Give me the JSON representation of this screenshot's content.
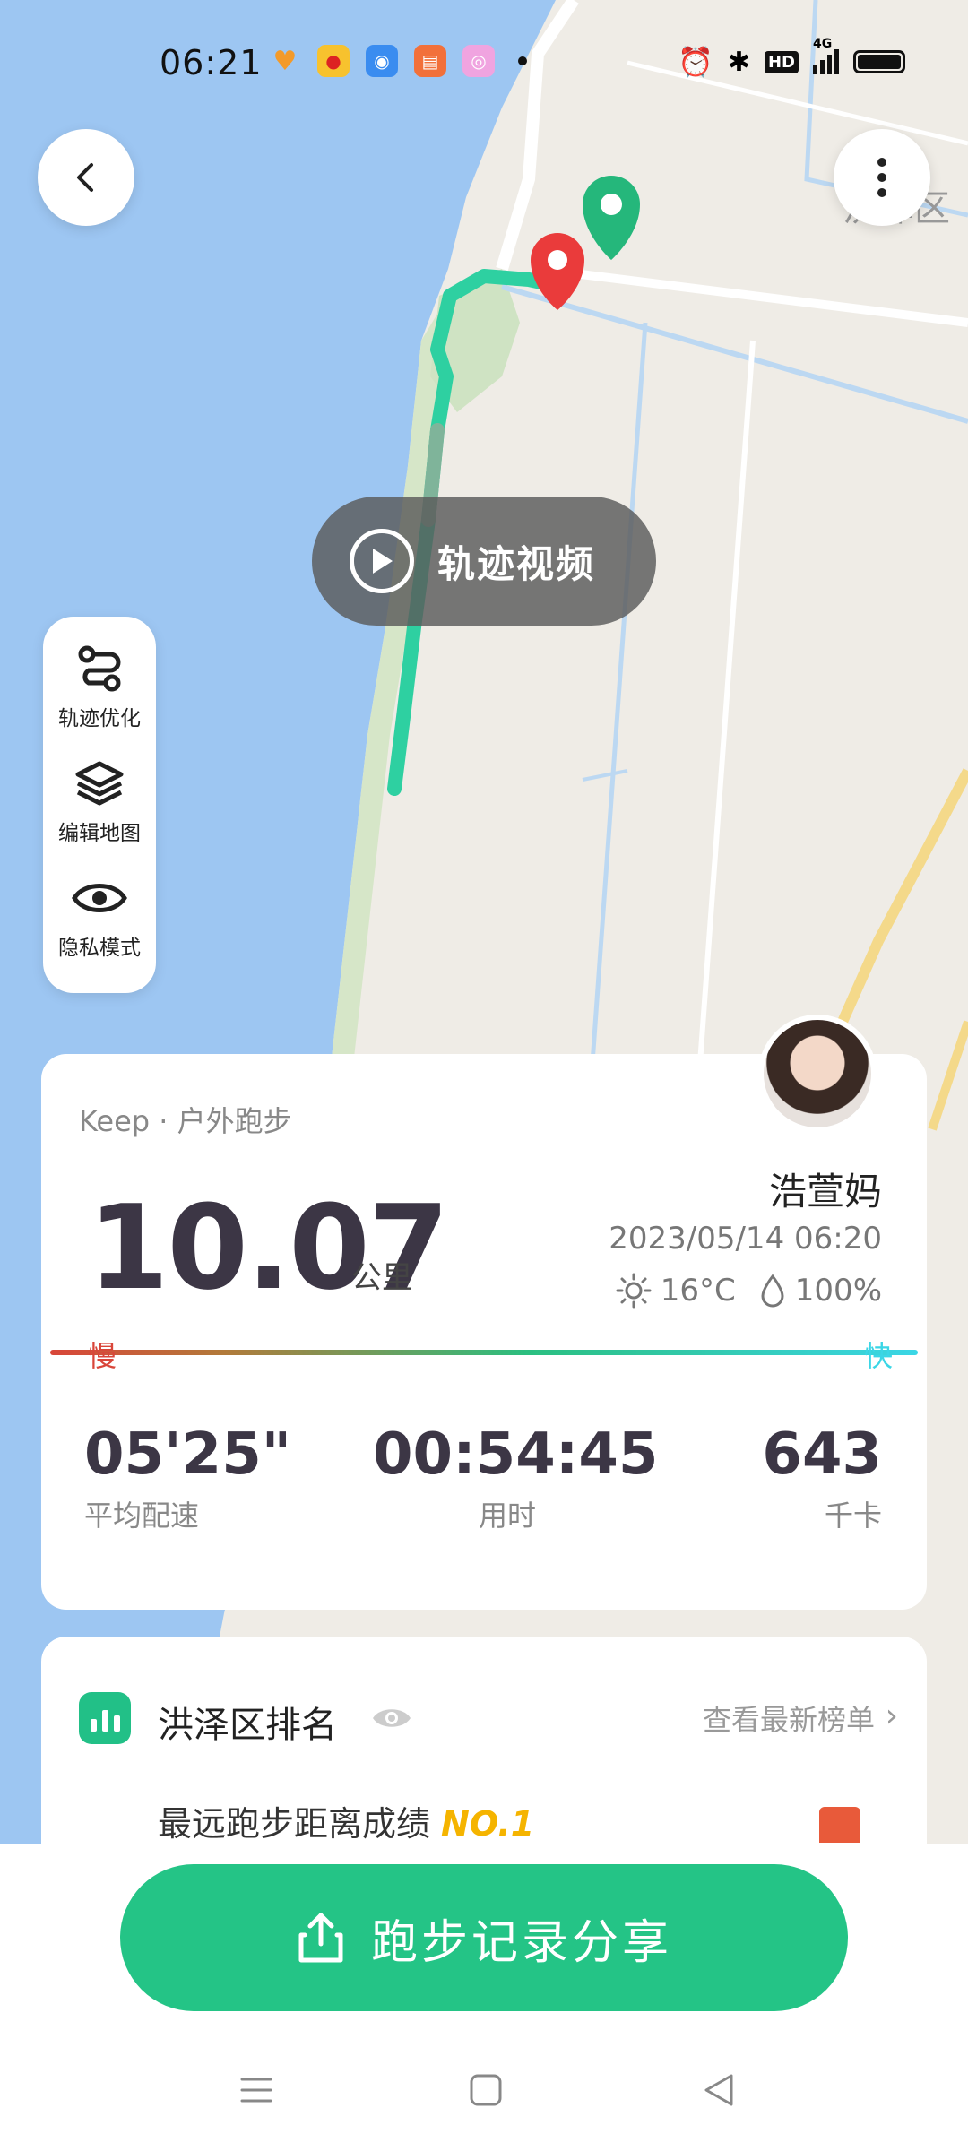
{
  "status_bar": {
    "time": "06:21",
    "network": "4G",
    "hd": "HD"
  },
  "map": {
    "district_label": "洪泽区",
    "video_button_label": "轨迹视频"
  },
  "map_tools": [
    {
      "label": "轨迹优化",
      "icon": "route-optimize-icon"
    },
    {
      "label": "编辑地图",
      "icon": "layers-icon"
    },
    {
      "label": "隐私模式",
      "icon": "eye-icon"
    }
  ],
  "summary": {
    "source": "Keep · 户外跑步",
    "distance": "10.07",
    "distance_unit": "公里",
    "user_name": "浩萱妈",
    "datetime": "2023/05/14 06:20",
    "temperature": "16°C",
    "humidity": "100%",
    "slow_label": "慢",
    "fast_label": "快",
    "stats": [
      {
        "value": "05'25\"",
        "label": "平均配速"
      },
      {
        "value": "00:54:45",
        "label": "用时"
      },
      {
        "value": "643",
        "label": "千卡"
      }
    ]
  },
  "ranking": {
    "title": "洪泽区排名",
    "link_label": "查看最新榜单",
    "best_text": "最远跑步距离成绩",
    "best_rank": "NO.1"
  },
  "share_button": {
    "label": "跑步记录分享"
  },
  "colors": {
    "accent": "#24c486",
    "slow": "#d9463a",
    "fast": "#3bd6e6",
    "water": "#9dc6f2"
  }
}
